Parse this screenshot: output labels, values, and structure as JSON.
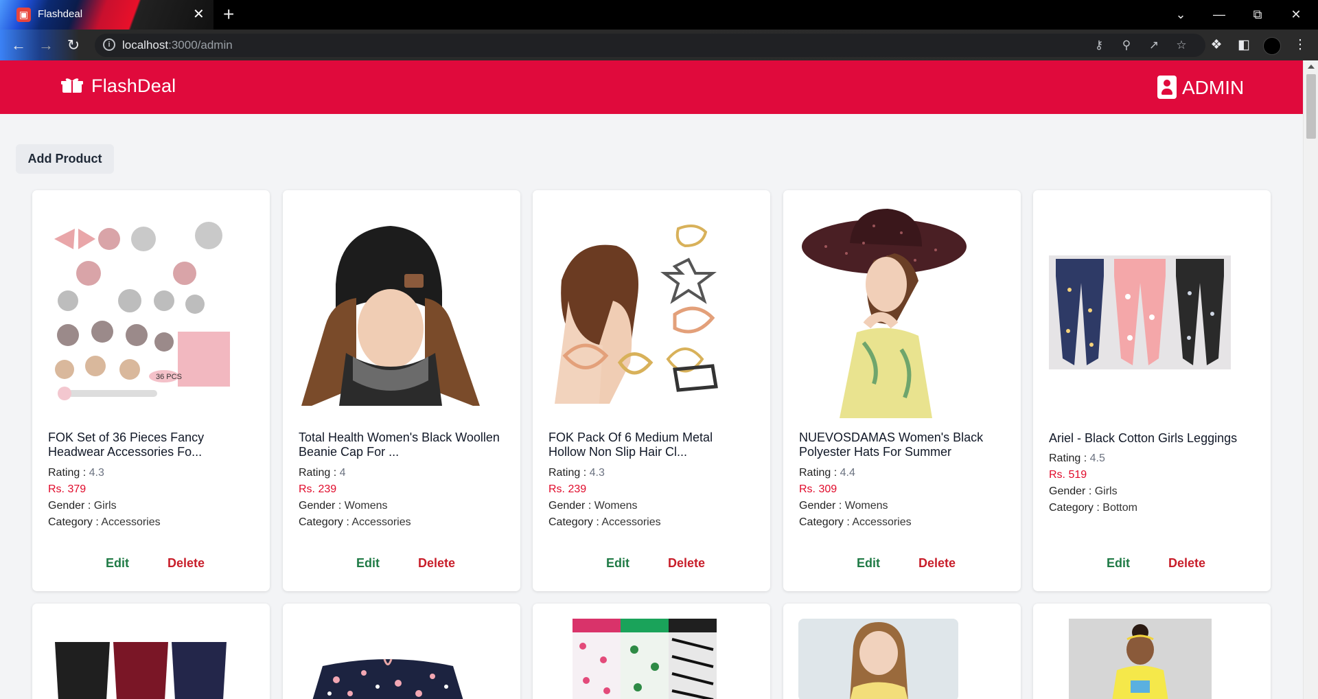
{
  "browser": {
    "tab_title": "Flashdeal",
    "url_host": "localhost",
    "url_path": ":3000/admin"
  },
  "navbar": {
    "logo_text": "FlashDeal",
    "admin_label": "ADMIN",
    "brand_color": "#e00a3c"
  },
  "actions": {
    "add_product": "Add Product",
    "edit": "Edit",
    "delete": "Delete"
  },
  "labels": {
    "rating": "Rating",
    "gender": "Gender",
    "category": "Category",
    "price_prefix": "Rs."
  },
  "products": [
    {
      "title_line1": "FOK Set of 36 Pieces Fancy",
      "title_line2": "Headwear Accessories Fo...",
      "rating": "4.3",
      "price": "Rs. 379",
      "gender": "Girls",
      "category": "Accessories"
    },
    {
      "title_line1": "Total Health Women's Black Woollen",
      "title_line2": "Beanie Cap For ...",
      "rating": "4",
      "price": "Rs. 239",
      "gender": "Womens",
      "category": "Accessories"
    },
    {
      "title_line1": "FOK Pack Of 6 Medium Metal",
      "title_line2": "Hollow Non Slip Hair Cl...",
      "rating": "4.3",
      "price": "Rs. 239",
      "gender": "Womens",
      "category": "Accessories"
    },
    {
      "title_line1": "NUEVOSDAMAS Women's Black",
      "title_line2": "Polyester Hats For Summer",
      "rating": "4.4",
      "price": "Rs. 309",
      "gender": "Womens",
      "category": "Accessories"
    },
    {
      "title_line1": "Ariel - Black Cotton Girls Leggings",
      "title_line2": "",
      "rating": "4.5",
      "price": "Rs. 519",
      "gender": "Girls",
      "category": "Bottom"
    }
  ]
}
